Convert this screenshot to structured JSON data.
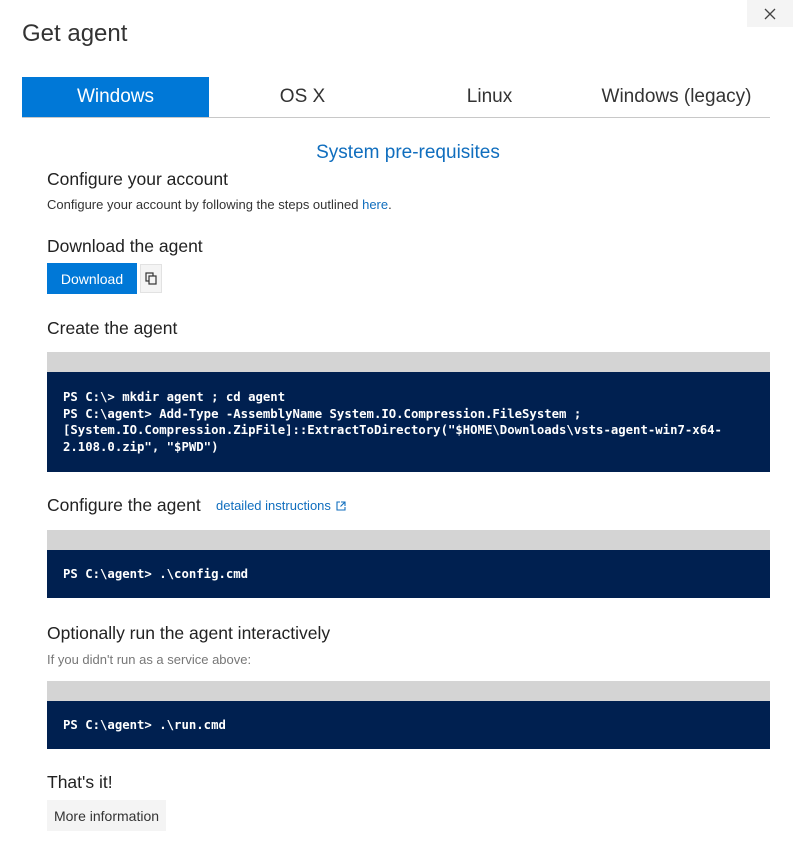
{
  "dialog": {
    "title": "Get agent",
    "close_icon": "close-icon"
  },
  "tabs": [
    {
      "label": "Windows",
      "active": true
    },
    {
      "label": "OS X",
      "active": false
    },
    {
      "label": "Linux",
      "active": false
    },
    {
      "label": "Windows (legacy)",
      "active": false
    }
  ],
  "prereq_link": "System pre-requisites",
  "configure_account": {
    "heading": "Configure your account",
    "text": "Configure your account by following the steps outlined ",
    "link": "here",
    "suffix": "."
  },
  "download_agent": {
    "heading": "Download the agent",
    "button": "Download",
    "copy_icon": "copy-icon"
  },
  "create_agent": {
    "heading": "Create the agent",
    "code": [
      "PS C:\\> mkdir agent ; cd agent",
      "PS C:\\agent> Add-Type -AssemblyName System.IO.Compression.FileSystem ;",
      "[System.IO.Compression.ZipFile]::ExtractToDirectory(\"$HOME\\Downloads\\vsts-agent-win7-x64-",
      "2.108.0.zip\", \"$PWD\")"
    ]
  },
  "configure_agent": {
    "heading": "Configure the agent",
    "link": "detailed instructions",
    "link_icon": "external-link-icon",
    "code": [
      "PS C:\\agent> .\\config.cmd"
    ]
  },
  "run_agent": {
    "heading": "Optionally run the agent interactively",
    "note": "If you didn't run as a service above:",
    "code": [
      "PS C:\\agent> .\\run.cmd"
    ]
  },
  "done": {
    "heading": "That's it!",
    "button": "More information"
  },
  "colors": {
    "accent": "#0078d7",
    "code_bg": "#002050",
    "link": "#106ebe"
  }
}
